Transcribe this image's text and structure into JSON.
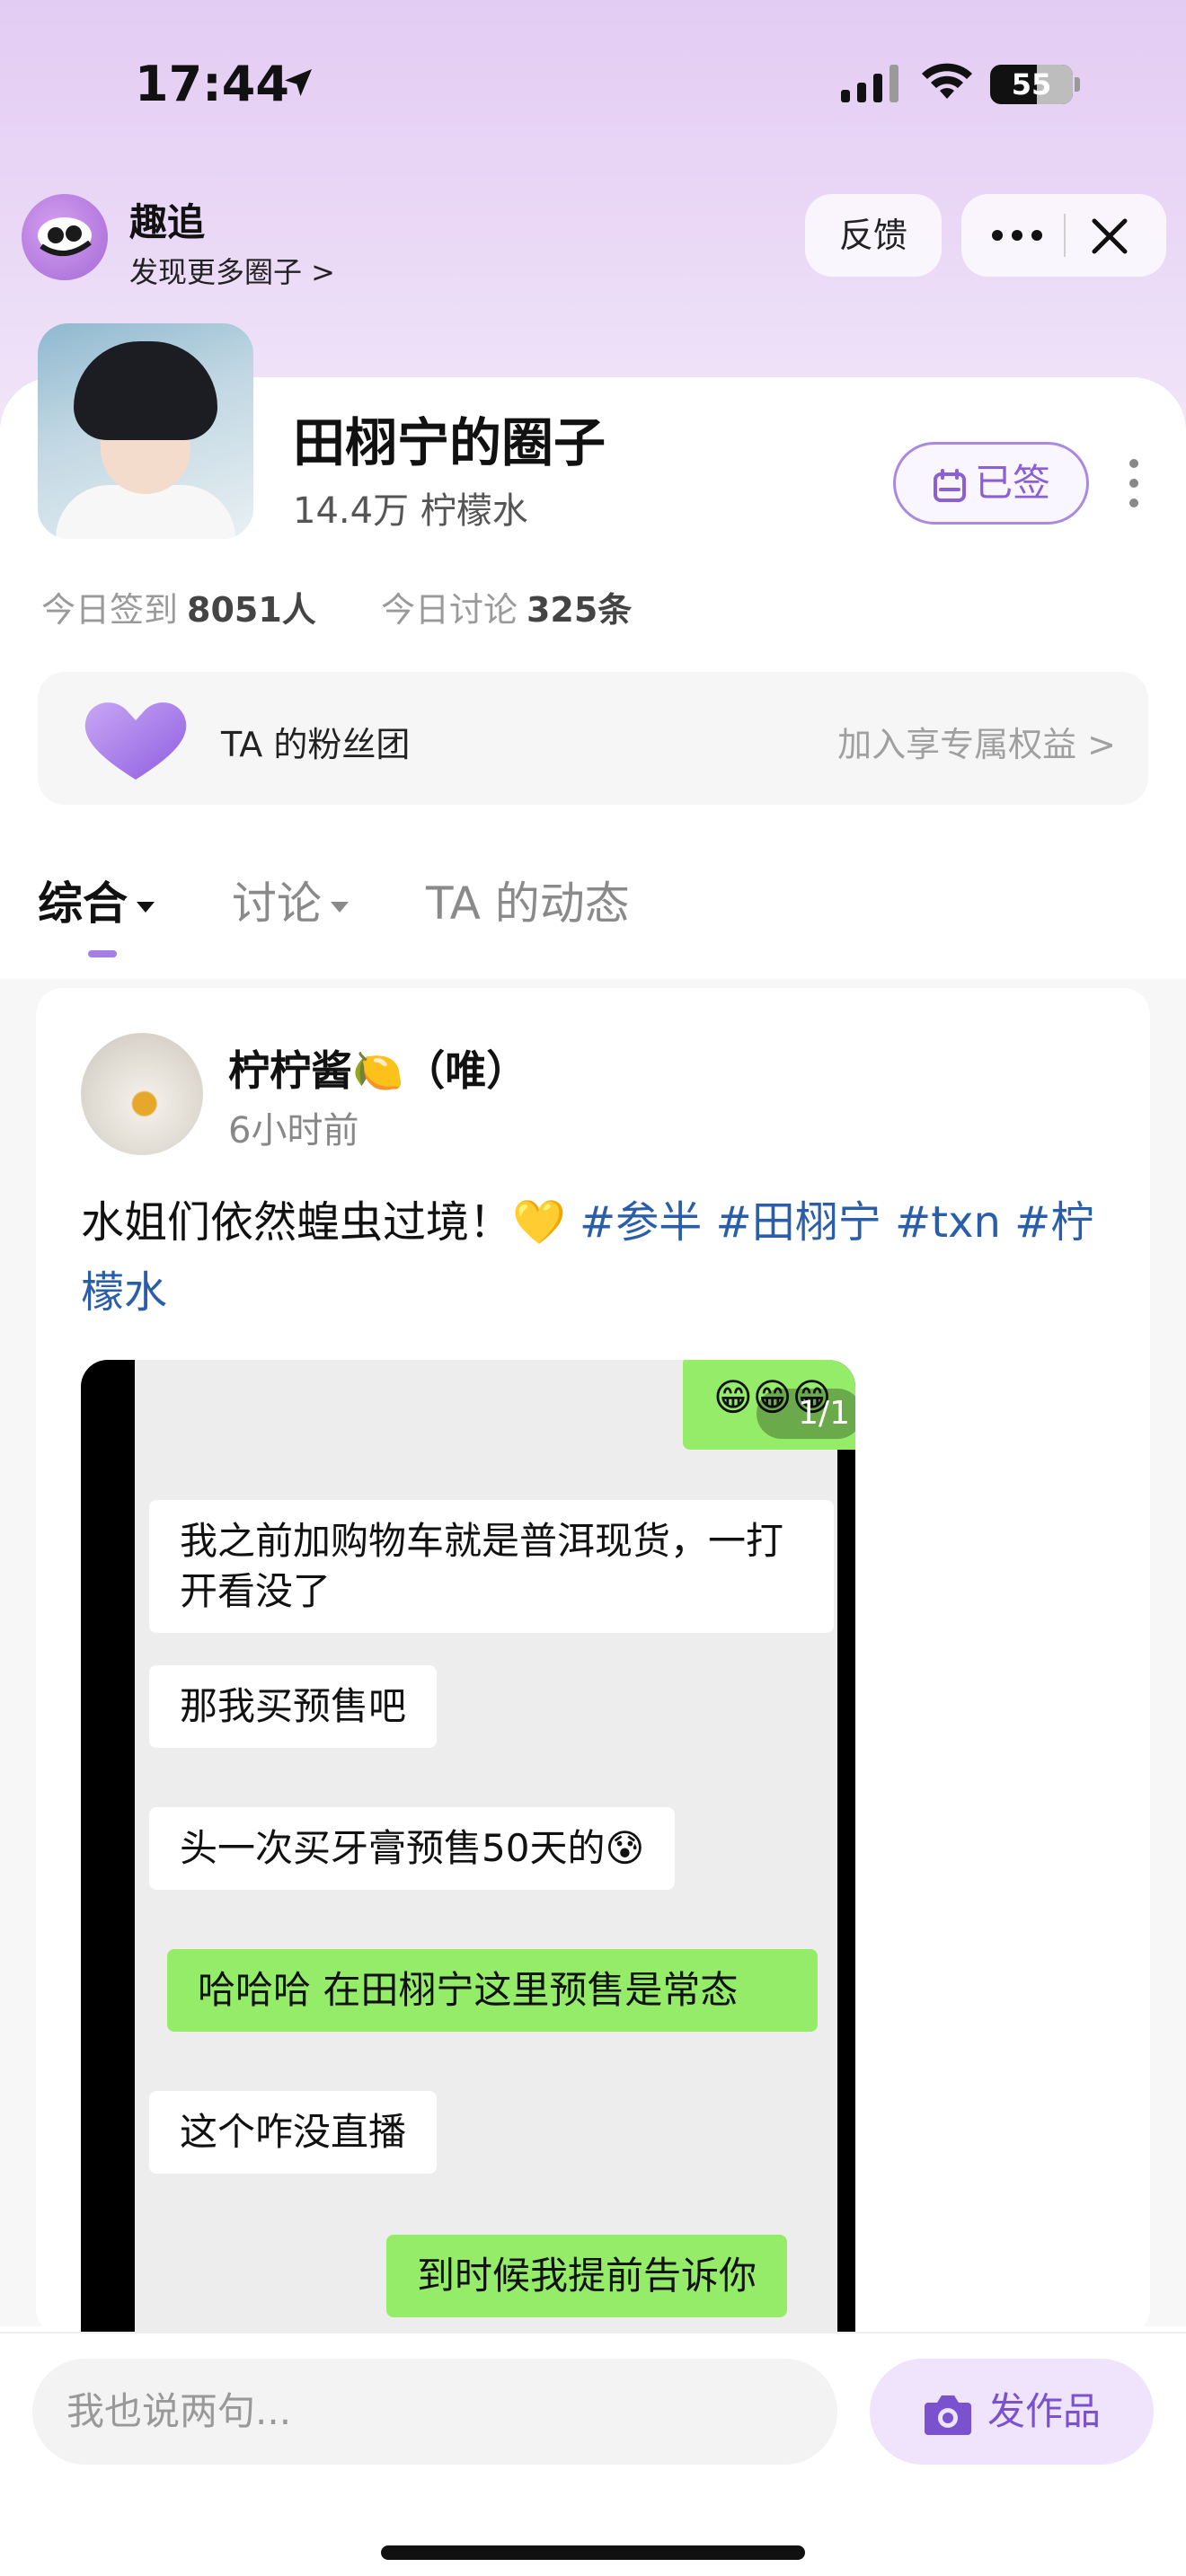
{
  "status_bar": {
    "time": "17:44",
    "battery": "55"
  },
  "app": {
    "name": "趣追",
    "subtitle": "发现更多圈子 >"
  },
  "header": {
    "feedback_label": "反馈"
  },
  "circle": {
    "title": "田栩宁的圈子",
    "members": "14.4万 柠檬水",
    "signed_label": "已签",
    "stats": {
      "checkin_label": "今日签到",
      "checkin_value": "8051人",
      "discuss_label": "今日讨论",
      "discuss_value": "325条"
    }
  },
  "fan_club": {
    "label": "TA 的粉丝团",
    "cta": "加入享专属权益 >"
  },
  "tabs": [
    {
      "label": "综合"
    },
    {
      "label": "讨论"
    },
    {
      "label": "TA 的动态"
    }
  ],
  "post": {
    "author": "柠柠酱🍋（唯）",
    "time": "6小时前",
    "text_main": "水姐们依然蝗虫过境！💛 ",
    "tags": [
      "#参半",
      "#田栩宁",
      "#txn",
      "#柠檬水"
    ],
    "image_page": "1/1",
    "chat": [
      {
        "side": "right",
        "text": "😁😁😁"
      },
      {
        "side": "left",
        "text": "我之前加购物车就是普洱现货，一打开看没了"
      },
      {
        "side": "left",
        "text": "那我买预售吧"
      },
      {
        "side": "left",
        "text": "头一次买牙膏预售50天的😰"
      },
      {
        "side": "right",
        "text": "哈哈哈 在田栩宁这里预售是常态"
      },
      {
        "side": "left",
        "text": "这个咋没直播"
      },
      {
        "side": "right",
        "text": "到时候我提前告诉你"
      }
    ]
  },
  "bottom": {
    "comment_placeholder": "我也说两句...",
    "publish_label": "发作品"
  },
  "colors": {
    "accent": "#8b5fd6",
    "tag": "#2b5ea8",
    "wechat_green": "#95ec69"
  }
}
